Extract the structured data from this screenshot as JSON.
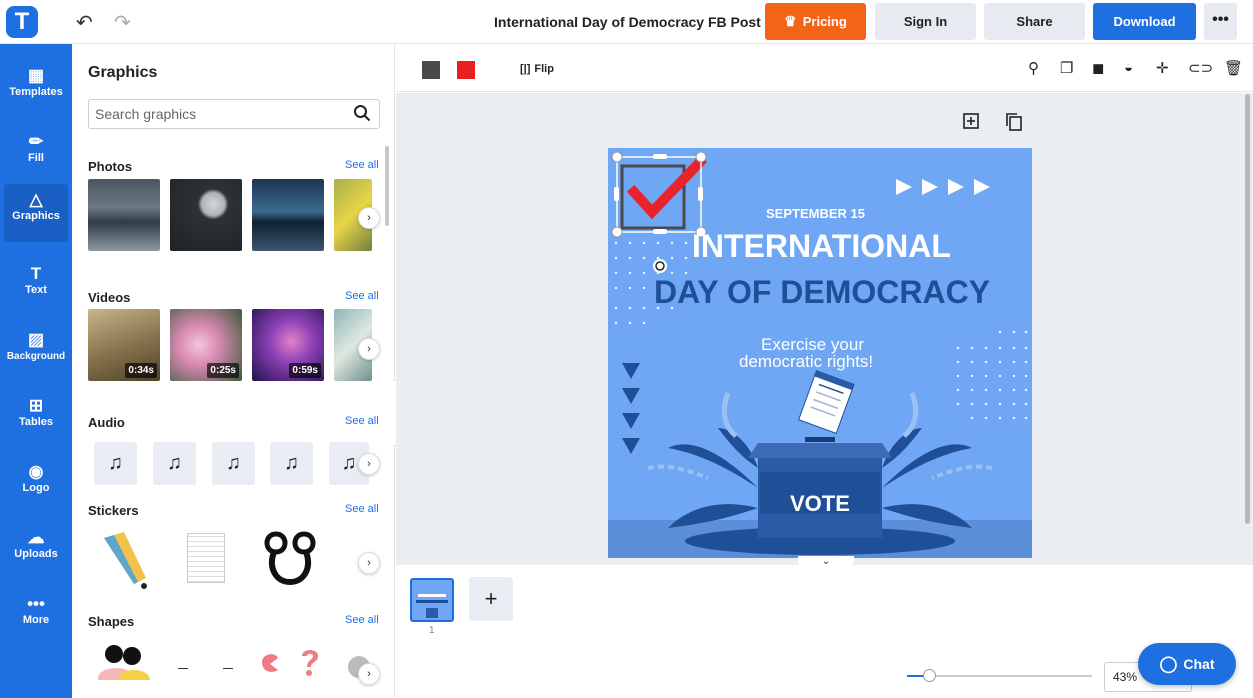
{
  "header": {
    "logo_letter": "T",
    "undo_icon": "undo-icon",
    "redo_icon": "redo-icon",
    "doc_title": "International Day of Democracy FB Post",
    "pricing_label": "Pricing",
    "signin_label": "Sign In",
    "share_label": "Share",
    "download_label": "Download",
    "more_label": "•••",
    "accent": "#1e6fe0",
    "pricing_color": "#f36419"
  },
  "rail": {
    "items": [
      {
        "label": "Templates",
        "icon": "templates-icon",
        "glyph": "▦"
      },
      {
        "label": "Fill",
        "icon": "pencil-icon",
        "glyph": "✏"
      },
      {
        "label": "Graphics",
        "icon": "shapes-icon",
        "glyph": "△"
      },
      {
        "label": "Text",
        "icon": "text-icon",
        "glyph": "T"
      },
      {
        "label": "Background",
        "icon": "background-icon",
        "glyph": "▨"
      },
      {
        "label": "Tables",
        "icon": "table-icon",
        "glyph": "⊞"
      },
      {
        "label": "Logo",
        "icon": "logo-icon",
        "glyph": "◉"
      },
      {
        "label": "Uploads",
        "icon": "upload-cloud-icon",
        "glyph": "☁"
      },
      {
        "label": "More",
        "icon": "more-icon",
        "glyph": "•••"
      }
    ],
    "active": "Graphics"
  },
  "panel": {
    "title": "Graphics",
    "search_placeholder": "Search graphics",
    "see_all": "See all",
    "sections": {
      "photos": "Photos",
      "videos": "Videos",
      "audio": "Audio",
      "stickers": "Stickers",
      "shapes": "Shapes"
    },
    "video_durations": [
      "0:34s",
      "0:25s",
      "0:59s"
    ]
  },
  "toolbar": {
    "swatch_colors": [
      "#4a4a4a",
      "#e82020"
    ],
    "flip_label": "Flip",
    "icons": [
      "paint-format-icon",
      "copy-icon",
      "layer-icon",
      "opacity-icon",
      "align-icon",
      "link-icon",
      "delete-icon"
    ]
  },
  "design": {
    "date": "SEPTEMBER 15",
    "title_line1": "INTERNATIONAL",
    "title_line2": "DAY OF DEMOCRACY",
    "tagline_line1": "Exercise your",
    "tagline_line2": "democratic rights!",
    "box_label": "VOTE",
    "bg_color": "#70a7f4",
    "dark_color": "#1f4f96",
    "check_color": "#e8232b"
  },
  "pages": {
    "current": "1",
    "add_label": "+"
  },
  "zoom": {
    "value": "43%",
    "fraction": 0.12
  },
  "chat_label": "Chat"
}
